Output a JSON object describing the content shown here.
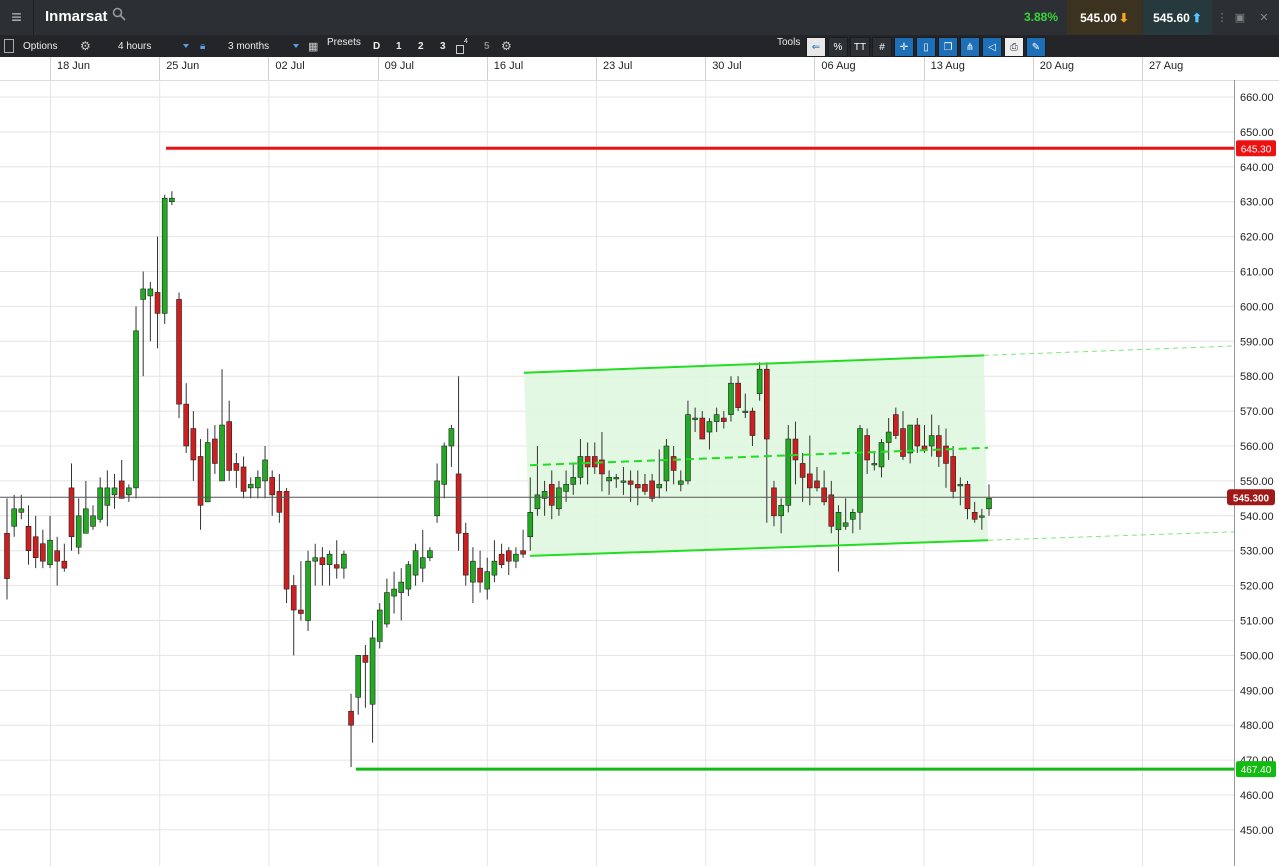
{
  "header": {
    "menu_icon": "hamburger-icon",
    "instrument": "Inmarsat",
    "search_icon": "search-icon",
    "change_pct": "3.88%",
    "sell_price": "545.00",
    "buy_price": "545.60",
    "accent_up": "#3ad43a",
    "accent_down": "#d42020"
  },
  "toolbar": {
    "options_label": "Options",
    "interval": "4 hours",
    "range": "3 months",
    "presets_label": "Presets",
    "presets": [
      "D",
      "1",
      "2",
      "3",
      "4",
      "5"
    ],
    "tools_label": "Tools",
    "percent_label": "%",
    "text_tool_label": "TT"
  },
  "chart_data": {
    "type": "candlestick",
    "x_ticks": [
      "18 Jun",
      "25 Jun",
      "02 Jul",
      "09 Jul",
      "16 Jul",
      "23 Jul",
      "30 Jul",
      "06 Aug",
      "13 Aug",
      "20 Aug",
      "27 Aug"
    ],
    "y_ticks": [
      "660.00",
      "650.00",
      "640.00",
      "630.00",
      "620.00",
      "610.00",
      "600.00",
      "590.00",
      "580.00",
      "570.00",
      "560.00",
      "550.00",
      "540.00",
      "530.00",
      "520.00",
      "510.00",
      "500.00",
      "490.00",
      "480.00",
      "470.00",
      "460.00",
      "450.00"
    ],
    "ylim": [
      446,
      664
    ],
    "current_price": 545.3,
    "current_price_label": "545.300",
    "resistance": {
      "value": 645.3,
      "label": "645.30",
      "color": "#ee1111"
    },
    "support": {
      "value": 467.4,
      "label": "467.40",
      "color": "#11bb11"
    },
    "channel": {
      "upper_start": 581,
      "upper_end": 586,
      "mid_start": 554.5,
      "mid_end": 559.5,
      "lower_start": 528.5,
      "lower_end": 533,
      "color": "#22dd22"
    },
    "candles": [
      {
        "o": 535,
        "h": 545,
        "l": 516,
        "c": 522
      },
      {
        "o": 537,
        "h": 546,
        "l": 534,
        "c": 542
      },
      {
        "o": 541,
        "h": 546,
        "l": 539,
        "c": 542
      },
      {
        "o": 537,
        "h": 543,
        "l": 526,
        "c": 530
      },
      {
        "o": 534,
        "h": 540,
        "l": 525,
        "c": 528
      },
      {
        "o": 532,
        "h": 536,
        "l": 525,
        "c": 527
      },
      {
        "o": 526,
        "h": 540,
        "l": 525,
        "c": 533
      },
      {
        "o": 530,
        "h": 534,
        "l": 520,
        "c": 527
      },
      {
        "o": 527,
        "h": 532,
        "l": 524,
        "c": 525
      },
      {
        "o": 548,
        "h": 555,
        "l": 530,
        "c": 534
      },
      {
        "o": 531,
        "h": 545,
        "l": 529,
        "c": 540
      },
      {
        "o": 535,
        "h": 550,
        "l": 535,
        "c": 542
      },
      {
        "o": 537,
        "h": 543,
        "l": 536,
        "c": 540
      },
      {
        "o": 539,
        "h": 551,
        "l": 538,
        "c": 548
      },
      {
        "o": 543,
        "h": 553,
        "l": 537,
        "c": 548
      },
      {
        "o": 546,
        "h": 552,
        "l": 542,
        "c": 548
      },
      {
        "o": 550,
        "h": 556,
        "l": 545,
        "c": 545
      },
      {
        "o": 546,
        "h": 549,
        "l": 544,
        "c": 548
      },
      {
        "o": 548,
        "h": 600,
        "l": 545,
        "c": 593
      },
      {
        "o": 602,
        "h": 610,
        "l": 580,
        "c": 605
      },
      {
        "o": 603,
        "h": 607,
        "l": 590,
        "c": 605
      },
      {
        "o": 604,
        "h": 620,
        "l": 588,
        "c": 598
      },
      {
        "o": 598,
        "h": 632,
        "l": 595,
        "c": 631
      },
      {
        "o": 630,
        "h": 633,
        "l": 629,
        "c": 631
      },
      {
        "o": 602,
        "h": 604,
        "l": 568,
        "c": 572
      },
      {
        "o": 572,
        "h": 578,
        "l": 558,
        "c": 560
      },
      {
        "o": 565,
        "h": 570,
        "l": 550,
        "c": 556
      },
      {
        "o": 557,
        "h": 562,
        "l": 536,
        "c": 543
      },
      {
        "o": 544,
        "h": 565,
        "l": 544,
        "c": 561
      },
      {
        "o": 562,
        "h": 566,
        "l": 552,
        "c": 555
      },
      {
        "o": 550,
        "h": 582,
        "l": 550,
        "c": 566
      },
      {
        "o": 567,
        "h": 573,
        "l": 550,
        "c": 553
      },
      {
        "o": 555,
        "h": 558,
        "l": 548,
        "c": 553
      },
      {
        "o": 554,
        "h": 557,
        "l": 545,
        "c": 547
      },
      {
        "o": 548,
        "h": 551,
        "l": 545,
        "c": 549
      },
      {
        "o": 548,
        "h": 553,
        "l": 545,
        "c": 551
      },
      {
        "o": 550,
        "h": 560,
        "l": 545,
        "c": 556
      },
      {
        "o": 551,
        "h": 553,
        "l": 540,
        "c": 546
      },
      {
        "o": 547,
        "h": 552,
        "l": 538,
        "c": 541
      },
      {
        "o": 547,
        "h": 548,
        "l": 515,
        "c": 519
      },
      {
        "o": 520,
        "h": 523,
        "l": 500,
        "c": 513
      },
      {
        "o": 513,
        "h": 527,
        "l": 510,
        "c": 512
      },
      {
        "o": 510,
        "h": 530,
        "l": 507,
        "c": 527
      },
      {
        "o": 527,
        "h": 532,
        "l": 520,
        "c": 528
      },
      {
        "o": 528,
        "h": 531,
        "l": 520,
        "c": 526
      },
      {
        "o": 526,
        "h": 530,
        "l": 520,
        "c": 529
      },
      {
        "o": 526,
        "h": 533,
        "l": 522,
        "c": 525
      },
      {
        "o": 525,
        "h": 530,
        "l": 522,
        "c": 529
      },
      {
        "o": 484,
        "h": 489,
        "l": 468,
        "c": 480
      },
      {
        "o": 488,
        "h": 500,
        "l": 483,
        "c": 500
      },
      {
        "o": 500,
        "h": 503,
        "l": 485,
        "c": 498
      },
      {
        "o": 486,
        "h": 510,
        "l": 475,
        "c": 505
      },
      {
        "o": 504,
        "h": 515,
        "l": 502,
        "c": 513
      },
      {
        "o": 509,
        "h": 522,
        "l": 508,
        "c": 518
      },
      {
        "o": 517,
        "h": 524,
        "l": 512,
        "c": 519
      },
      {
        "o": 518,
        "h": 525,
        "l": 510,
        "c": 521
      },
      {
        "o": 519,
        "h": 527,
        "l": 517,
        "c": 526
      },
      {
        "o": 523,
        "h": 532,
        "l": 520,
        "c": 530
      },
      {
        "o": 525,
        "h": 536,
        "l": 521,
        "c": 528
      },
      {
        "o": 528,
        "h": 531,
        "l": 527,
        "c": 530
      },
      {
        "o": 540,
        "h": 555,
        "l": 538,
        "c": 550
      },
      {
        "o": 549,
        "h": 561,
        "l": 545,
        "c": 560
      },
      {
        "o": 560,
        "h": 566,
        "l": 554,
        "c": 565
      },
      {
        "o": 552,
        "h": 580,
        "l": 530,
        "c": 535
      },
      {
        "o": 535,
        "h": 538,
        "l": 520,
        "c": 523
      },
      {
        "o": 521,
        "h": 531,
        "l": 515,
        "c": 527
      },
      {
        "o": 525,
        "h": 530,
        "l": 518,
        "c": 521
      },
      {
        "o": 519,
        "h": 528,
        "l": 516,
        "c": 524
      },
      {
        "o": 523,
        "h": 533,
        "l": 521,
        "c": 527
      },
      {
        "o": 529,
        "h": 532,
        "l": 525,
        "c": 526
      },
      {
        "o": 530,
        "h": 531,
        "l": 523,
        "c": 527
      },
      {
        "o": 527,
        "h": 531,
        "l": 525,
        "c": 529
      },
      {
        "o": 530,
        "h": 536,
        "l": 528,
        "c": 529
      },
      {
        "o": 534,
        "h": 551,
        "l": 530,
        "c": 541
      },
      {
        "o": 542,
        "h": 560,
        "l": 540,
        "c": 546
      },
      {
        "o": 545,
        "h": 550,
        "l": 540,
        "c": 547
      },
      {
        "o": 549,
        "h": 553,
        "l": 539,
        "c": 543
      },
      {
        "o": 542,
        "h": 550,
        "l": 540,
        "c": 548
      },
      {
        "o": 547,
        "h": 553,
        "l": 544,
        "c": 549
      },
      {
        "o": 549,
        "h": 555,
        "l": 546,
        "c": 551
      },
      {
        "o": 551,
        "h": 562,
        "l": 549,
        "c": 557
      },
      {
        "o": 557,
        "h": 561,
        "l": 549,
        "c": 554
      },
      {
        "o": 557,
        "h": 561,
        "l": 552,
        "c": 554
      },
      {
        "o": 556,
        "h": 564,
        "l": 547,
        "c": 552
      },
      {
        "o": 550,
        "h": 553,
        "l": 546,
        "c": 551
      },
      {
        "o": 551,
        "h": 552,
        "l": 548,
        "c": 551
      },
      {
        "o": 550,
        "h": 554,
        "l": 546,
        "c": 550
      },
      {
        "o": 550,
        "h": 553,
        "l": 544,
        "c": 549
      },
      {
        "o": 549,
        "h": 553,
        "l": 543,
        "c": 548
      },
      {
        "o": 549,
        "h": 552,
        "l": 546,
        "c": 547
      },
      {
        "o": 550,
        "h": 552,
        "l": 544,
        "c": 545
      },
      {
        "o": 548,
        "h": 559,
        "l": 545,
        "c": 549
      },
      {
        "o": 550,
        "h": 562,
        "l": 547,
        "c": 560
      },
      {
        "o": 557,
        "h": 560,
        "l": 549,
        "c": 553
      },
      {
        "o": 549,
        "h": 553,
        "l": 547,
        "c": 550
      },
      {
        "o": 550,
        "h": 573,
        "l": 549,
        "c": 569
      },
      {
        "o": 568,
        "h": 571,
        "l": 564,
        "c": 568
      },
      {
        "o": 568,
        "h": 570,
        "l": 562,
        "c": 562
      },
      {
        "o": 564,
        "h": 568,
        "l": 559,
        "c": 567
      },
      {
        "o": 567,
        "h": 571,
        "l": 564,
        "c": 569
      },
      {
        "o": 568,
        "h": 570,
        "l": 565,
        "c": 567
      },
      {
        "o": 569,
        "h": 580,
        "l": 567,
        "c": 578
      },
      {
        "o": 578,
        "h": 580,
        "l": 570,
        "c": 571
      },
      {
        "o": 570,
        "h": 575,
        "l": 568,
        "c": 570
      },
      {
        "o": 570,
        "h": 571,
        "l": 560,
        "c": 563
      },
      {
        "o": 575,
        "h": 584,
        "l": 573,
        "c": 582
      },
      {
        "o": 582,
        "h": 584,
        "l": 538,
        "c": 562
      },
      {
        "o": 548,
        "h": 550,
        "l": 537,
        "c": 540
      },
      {
        "o": 540,
        "h": 545,
        "l": 535,
        "c": 543
      },
      {
        "o": 543,
        "h": 566,
        "l": 541,
        "c": 562
      },
      {
        "o": 562,
        "h": 567,
        "l": 549,
        "c": 556
      },
      {
        "o": 555,
        "h": 558,
        "l": 544,
        "c": 551
      },
      {
        "o": 552,
        "h": 563,
        "l": 543,
        "c": 548
      },
      {
        "o": 550,
        "h": 554,
        "l": 547,
        "c": 548
      },
      {
        "o": 548,
        "h": 553,
        "l": 543,
        "c": 544
      },
      {
        "o": 546,
        "h": 550,
        "l": 535,
        "c": 537
      },
      {
        "o": 536,
        "h": 543,
        "l": 524,
        "c": 541
      },
      {
        "o": 537,
        "h": 545,
        "l": 536,
        "c": 538
      },
      {
        "o": 539,
        "h": 542,
        "l": 535,
        "c": 541
      },
      {
        "o": 541,
        "h": 566,
        "l": 536,
        "c": 565
      },
      {
        "o": 563,
        "h": 565,
        "l": 552,
        "c": 556
      },
      {
        "o": 555,
        "h": 558,
        "l": 553,
        "c": 555
      },
      {
        "o": 554,
        "h": 562,
        "l": 551,
        "c": 561
      },
      {
        "o": 561,
        "h": 568,
        "l": 556,
        "c": 564
      },
      {
        "o": 569,
        "h": 571,
        "l": 562,
        "c": 563
      },
      {
        "o": 565,
        "h": 570,
        "l": 556,
        "c": 557
      },
      {
        "o": 558,
        "h": 566,
        "l": 555,
        "c": 566
      },
      {
        "o": 566,
        "h": 568,
        "l": 558,
        "c": 560
      },
      {
        "o": 560,
        "h": 566,
        "l": 558,
        "c": 559
      },
      {
        "o": 560,
        "h": 569,
        "l": 557,
        "c": 563
      },
      {
        "o": 563,
        "h": 566,
        "l": 554,
        "c": 557
      },
      {
        "o": 560,
        "h": 565,
        "l": 548,
        "c": 555
      },
      {
        "o": 557,
        "h": 560,
        "l": 545,
        "c": 547
      },
      {
        "o": 549,
        "h": 551,
        "l": 543,
        "c": 549
      },
      {
        "o": 549,
        "h": 550,
        "l": 539,
        "c": 542
      },
      {
        "o": 541,
        "h": 544,
        "l": 538,
        "c": 539
      },
      {
        "o": 540,
        "h": 542,
        "l": 536,
        "c": 540
      },
      {
        "o": 542,
        "h": 549,
        "l": 540,
        "c": 545
      }
    ]
  }
}
